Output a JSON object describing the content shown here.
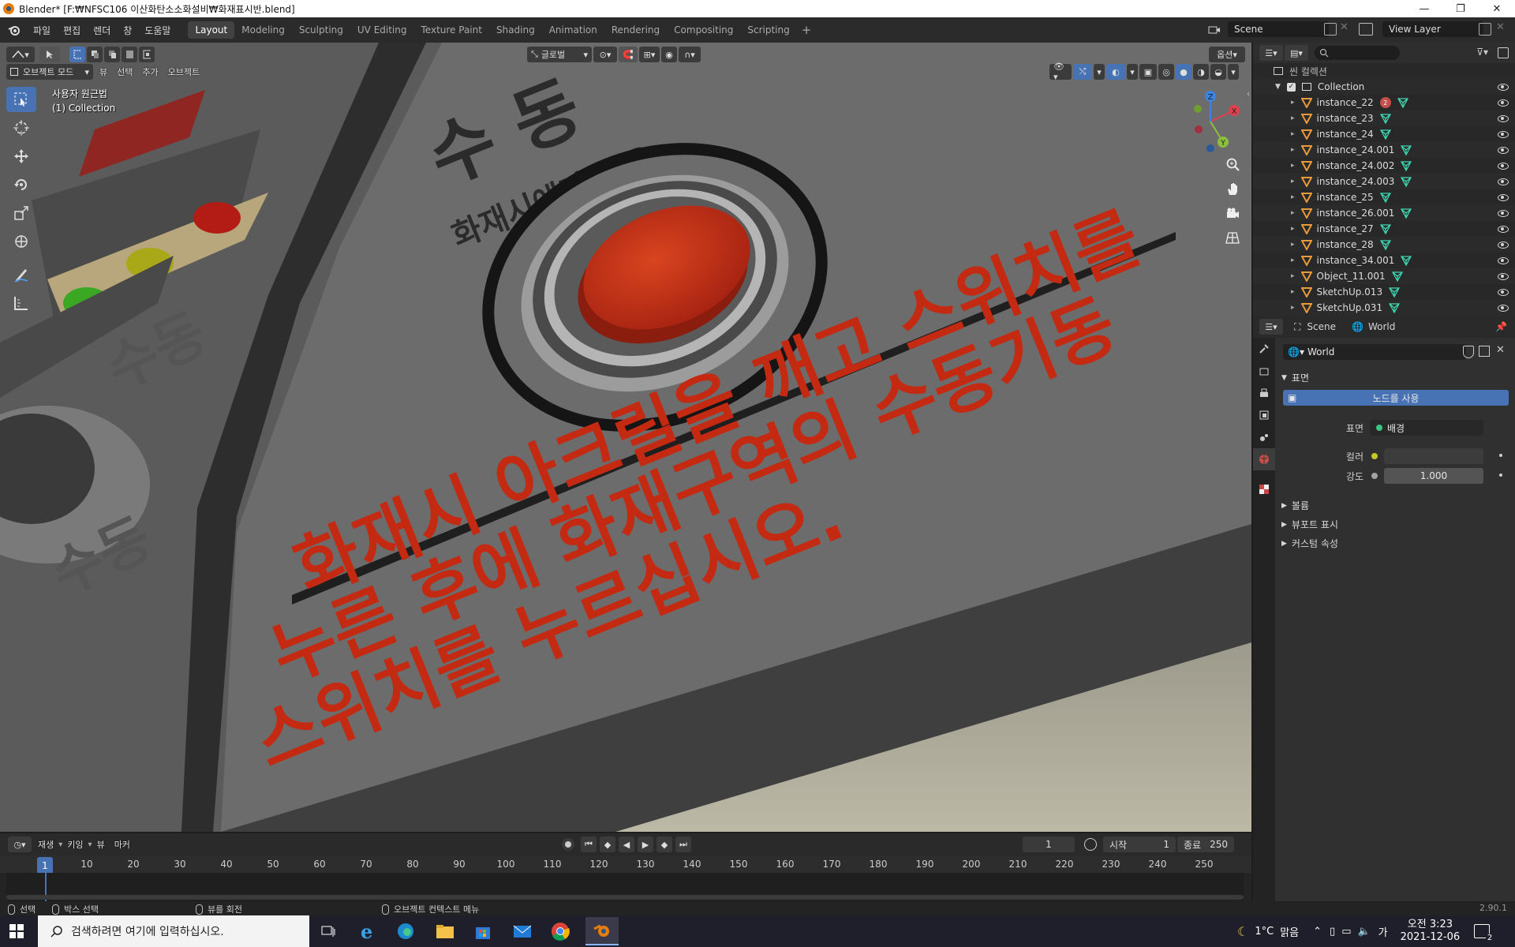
{
  "window": {
    "title": "Blender* [F:₩NFSC106 이산화탄소소화설비₩화재표시반.blend]",
    "minimize": "—",
    "maximize": "❐",
    "close": "✕"
  },
  "menubar": {
    "items": [
      "파일",
      "편집",
      "렌더",
      "창",
      "도움말"
    ]
  },
  "workspaces": {
    "tabs": [
      "Layout",
      "Modeling",
      "Sculpting",
      "UV Editing",
      "Texture Paint",
      "Shading",
      "Animation",
      "Rendering",
      "Compositing",
      "Scripting"
    ],
    "active": "Layout",
    "add": "+"
  },
  "scene_selector": {
    "value": "Scene"
  },
  "viewlayer_selector": {
    "value": "View Layer"
  },
  "viewport": {
    "header": {
      "mode": "오브젝트 모드",
      "menus": [
        "뷰",
        "선택",
        "추가",
        "오브젝트"
      ],
      "orientation": "글로벌",
      "options": "옵션"
    },
    "info_line1": "사용자 원근법",
    "info_line2": "(1) Collection",
    "tools": [
      "select-box-tool",
      "cursor-tool",
      "move-tool",
      "rotate-tool",
      "scale-tool",
      "transform-tool",
      "annotate-tool",
      "measure-tool"
    ],
    "gizmo": {
      "x": "X",
      "y": "Y",
      "z": "Z"
    },
    "scene_text": {
      "line1": "화재시 아크릴을 깨고 스위치를",
      "line2": "누른 후에 화재구역의 수동기동",
      "line3": "스위치를 누르십시오.",
      "top_label": "수 동",
      "top_small": "화재시에만 사용",
      "left_label1": "수동",
      "left_label2": "수동"
    },
    "colors": {
      "panel_gray": "#6a6a6a",
      "button_red": "#c8361b",
      "text_red": "#c42a12",
      "lamp_green": "#3aa822",
      "lamp_yellow": "#a8a818",
      "lamp_red": "#b31c14"
    }
  },
  "timeline": {
    "menus": [
      "재생",
      "키잉",
      "뷰",
      "마커"
    ],
    "current_frame": "1",
    "start_label": "시작",
    "start_value": "1",
    "end_label": "종료",
    "end_value": "250",
    "ruler": [
      "10",
      "20",
      "30",
      "40",
      "50",
      "60",
      "70",
      "80",
      "90",
      "100",
      "110",
      "120",
      "130",
      "140",
      "150",
      "160",
      "170",
      "180",
      "190",
      "200",
      "210",
      "220",
      "230",
      "240",
      "250"
    ],
    "cursor_label": "1"
  },
  "statusbar": {
    "select": "선택",
    "box_select": "박스 선택",
    "rotate_view": "뷰를 회전",
    "context_menu": "오브젝트 컨텍스트 메뉴",
    "version": "2.90.1"
  },
  "outliner": {
    "root": "씬 컬렉션",
    "collection": "Collection",
    "items": [
      {
        "name": "instance_22",
        "badge": "2"
      },
      {
        "name": "instance_23"
      },
      {
        "name": "instance_24"
      },
      {
        "name": "instance_24.001"
      },
      {
        "name": "instance_24.002"
      },
      {
        "name": "instance_24.003"
      },
      {
        "name": "instance_25"
      },
      {
        "name": "instance_26.001"
      },
      {
        "name": "instance_27"
      },
      {
        "name": "instance_28"
      },
      {
        "name": "instance_34.001"
      },
      {
        "name": "Object_11.001"
      },
      {
        "name": "SketchUp.013"
      },
      {
        "name": "SketchUp.031"
      }
    ]
  },
  "properties": {
    "breadcrumb_scene": "Scene",
    "breadcrumb_world": "World",
    "world_name": "World",
    "surface_section": "표면",
    "use_nodes_button": "노드를 사용",
    "surface_label": "표면",
    "surface_value": "배경",
    "color_label": "컬러",
    "strength_label": "강도",
    "strength_value": "1.000",
    "collapsed_sections": [
      "볼륨",
      "뷰포트 표시",
      "커스텀 속성"
    ]
  },
  "taskbar": {
    "search_placeholder": "검색하려면 여기에 입력하십시오.",
    "weather_temp": "1°C",
    "weather_desc": "맑음",
    "ime": "가",
    "time": "오전 3:23",
    "date": "2021-12-06",
    "notifications": "2"
  }
}
